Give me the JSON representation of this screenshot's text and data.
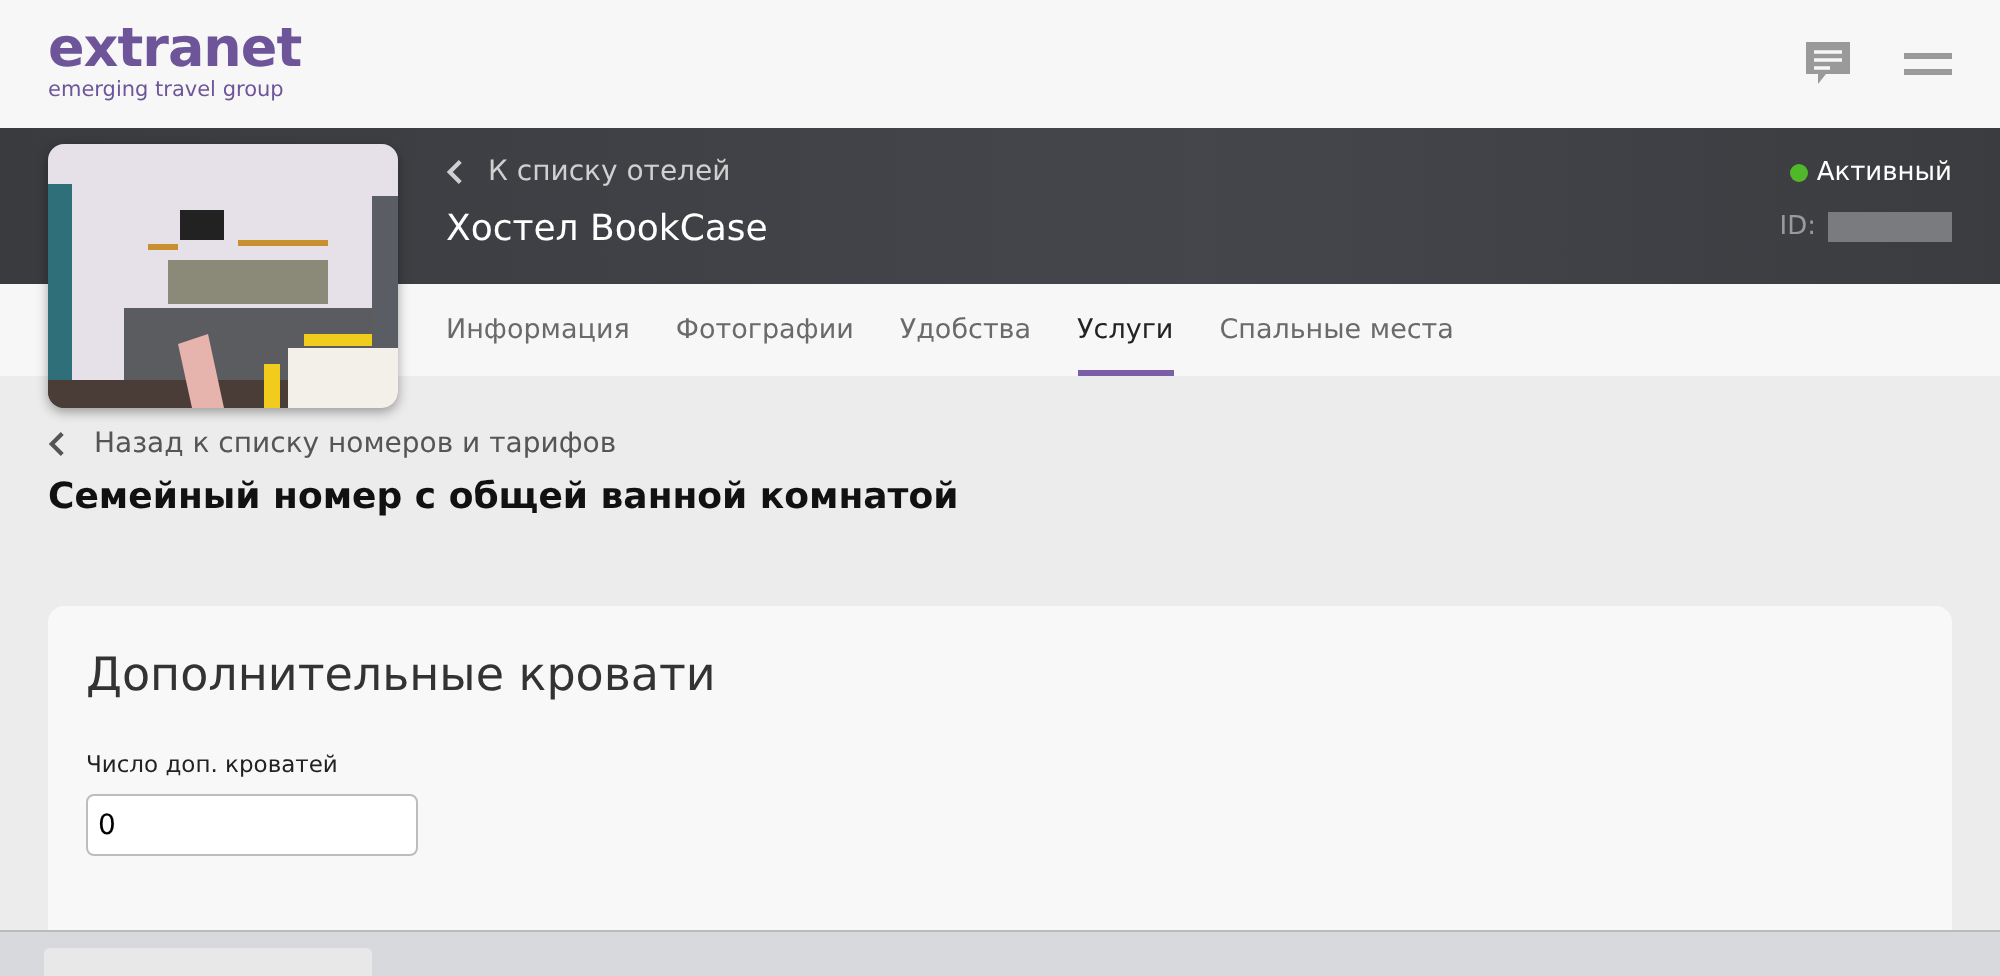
{
  "logo": {
    "name": "extranet",
    "tagline": "emerging travel group"
  },
  "hotel": {
    "back_link": "К списку отелей",
    "name": "Хостел BookCase",
    "status": {
      "label": "Активный",
      "color": "#52b82b"
    },
    "id_label": "ID:"
  },
  "tabs": [
    {
      "label": "Информация",
      "selected": false
    },
    {
      "label": "Фотографии",
      "selected": false
    },
    {
      "label": "Удобства",
      "selected": false
    },
    {
      "label": "Услуги",
      "selected": true
    },
    {
      "label": "Спальные места",
      "selected": false
    }
  ],
  "back_link": "Назад к списку номеров и тарифов",
  "room_title": "Семейный номер с общей ванной комнатой",
  "section": {
    "title": "Дополнительные кровати",
    "field": {
      "label": "Число доп. кроватей",
      "value": "0"
    }
  }
}
